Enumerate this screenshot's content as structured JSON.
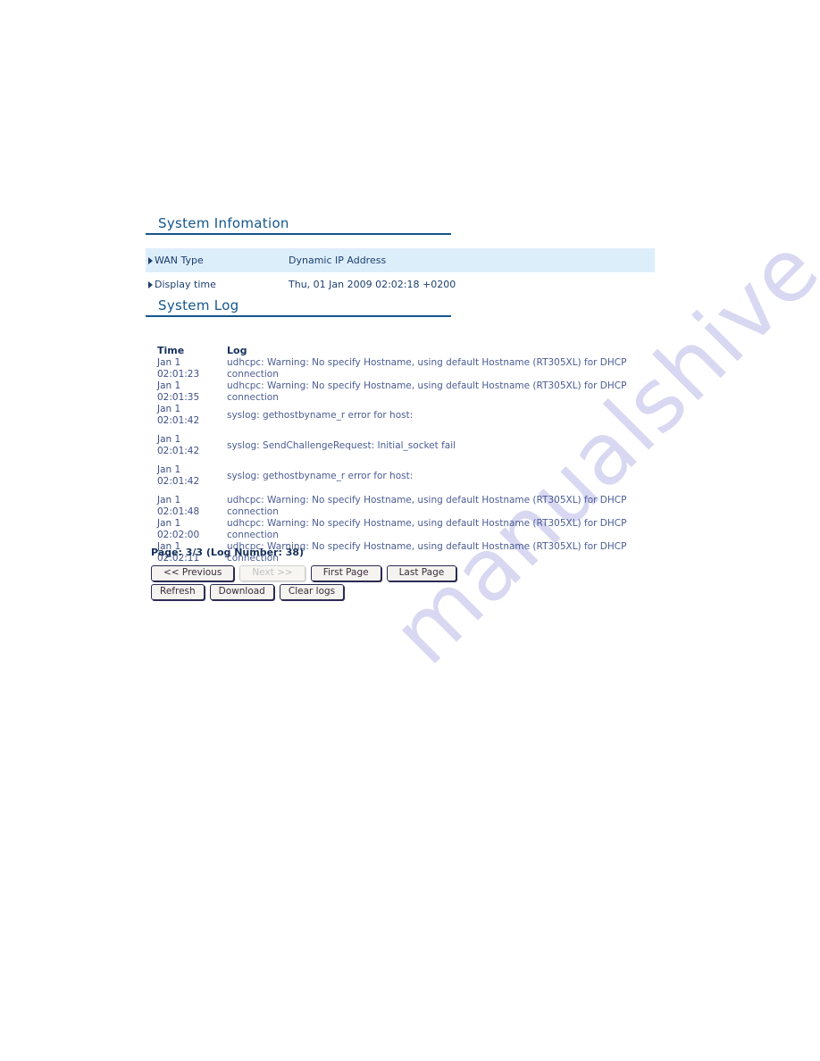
{
  "sections": {
    "system_information": {
      "title": "System Infomation",
      "rows": [
        {
          "label": "WAN Type",
          "value": "Dynamic IP Address"
        },
        {
          "label": "Display time",
          "value": "Thu, 01 Jan 2009 02:02:18 +0200"
        }
      ]
    },
    "system_log": {
      "title": "System Log",
      "columns": {
        "time": "Time",
        "log": "Log"
      },
      "entries": [
        {
          "time": "Jan 1\n02:01:23",
          "message": "udhcpc: Warning: No specify Hostname, using default Hostname (RT305XL) for DHCP connection"
        },
        {
          "time": "Jan 1\n02:01:35",
          "message": "udhcpc: Warning: No specify Hostname, using default Hostname (RT305XL) for DHCP connection"
        },
        {
          "time": "Jan 1\n02:01:42",
          "message": "syslog: gethostbyname_r error for host:"
        },
        {
          "time": "Jan 1\n02:01:42",
          "message": "syslog: SendChallengeRequest: Initial_socket fail"
        },
        {
          "time": "Jan 1\n02:01:42",
          "message": "syslog: gethostbyname_r error for host:"
        },
        {
          "time": "Jan 1\n02:01:48",
          "message": "udhcpc: Warning: No specify Hostname, using default Hostname (RT305XL) for DHCP connection"
        },
        {
          "time": "Jan 1\n02:02:00",
          "message": "udhcpc: Warning: No specify Hostname, using default Hostname (RT305XL) for DHCP connection"
        },
        {
          "time": "Jan 1\n02:02:11",
          "message": "udhcpc: Warning: No specify Hostname, using default Hostname (RT305XL) for DHCP connection"
        }
      ],
      "status": "Page: 3/3 (Log Number: 38)",
      "buttons": {
        "previous": "<< Previous",
        "next": "Next >>",
        "first_page": "First Page",
        "last_page": "Last Page",
        "refresh": "Refresh",
        "download": "Download",
        "clear_logs": "Clear logs"
      }
    }
  },
  "watermark": {
    "text": "manualshive.com"
  },
  "colors": {
    "heading": "#14568c",
    "row_shade": "#ddeefb",
    "log_text": "#4b5c93",
    "status_text": "#16305c",
    "watermark": "#d8d8f2"
  }
}
